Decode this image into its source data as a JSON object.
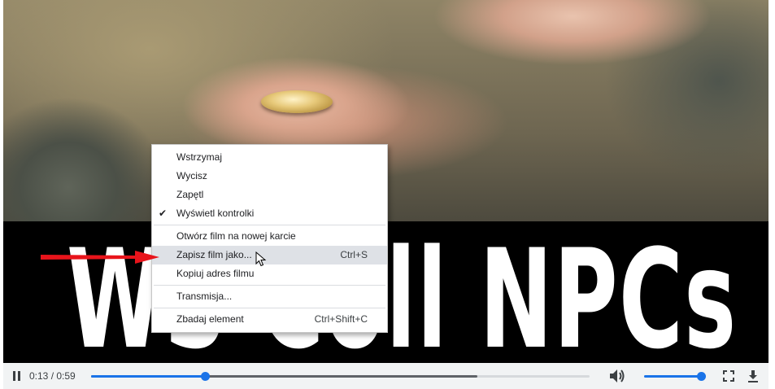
{
  "video": {
    "overlay_text": "WS Coll NPCs"
  },
  "controls": {
    "current_time": "0:13",
    "separator": " / ",
    "duration": "0:59",
    "progress_fraction": 0.228,
    "buffered_fraction": 0.775,
    "volume_fraction": 1.0,
    "icons": {
      "play_pause": "pause-icon",
      "volume": "volume-icon",
      "fullscreen": "fullscreen-icon",
      "download": "download-icon"
    }
  },
  "context_menu": {
    "groups": [
      [
        {
          "label": "Wstrzymaj",
          "shortcut": "",
          "checked": false,
          "highlighted": false
        },
        {
          "label": "Wycisz",
          "shortcut": "",
          "checked": false,
          "highlighted": false
        },
        {
          "label": "Zapętl",
          "shortcut": "",
          "checked": false,
          "highlighted": false
        },
        {
          "label": "Wyświetl kontrolki",
          "shortcut": "",
          "checked": true,
          "highlighted": false
        }
      ],
      [
        {
          "label": "Otwórz film na nowej karcie",
          "shortcut": "",
          "checked": false,
          "highlighted": false
        },
        {
          "label": "Zapisz film jako...",
          "shortcut": "Ctrl+S",
          "checked": false,
          "highlighted": true
        },
        {
          "label": "Kopiuj adres filmu",
          "shortcut": "",
          "checked": false,
          "highlighted": false
        }
      ],
      [
        {
          "label": "Transmisja...",
          "shortcut": "",
          "checked": false,
          "highlighted": false
        }
      ],
      [
        {
          "label": "Zbadaj element",
          "shortcut": "Ctrl+Shift+C",
          "checked": false,
          "highlighted": false
        }
      ]
    ],
    "check_glyph": "✔"
  },
  "annotations": {
    "arrow_color": "#e8141b",
    "arrow_icon": "red-arrow-icon"
  },
  "colors": {
    "accent": "#1a73e8",
    "controls_bg": "#f1f3f4",
    "menu_highlight": "#dee1e6"
  }
}
